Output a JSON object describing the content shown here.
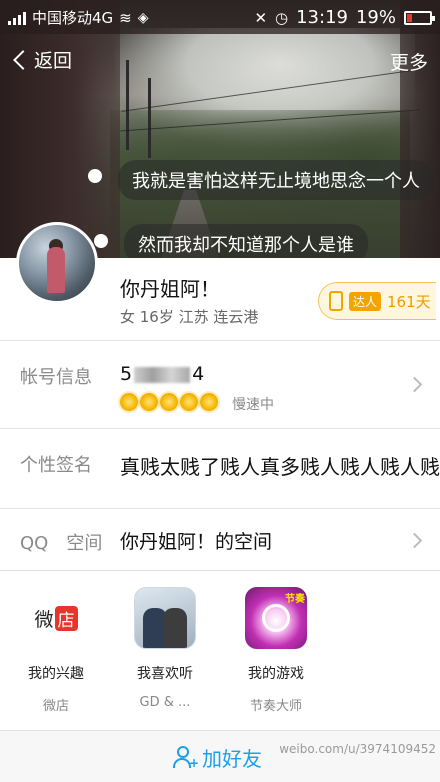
{
  "status_bar": {
    "carrier": "中国移动4G",
    "time": "13:19",
    "battery_percent": "19%"
  },
  "nav": {
    "back_label": "返回",
    "more_label": "更多"
  },
  "cover": {
    "bubble_1": "我就是害怕这样无止境地思念一个人",
    "bubble_2": "然而我却不知道那个人是谁"
  },
  "profile": {
    "name": "你丹姐阿！",
    "meta": "女  16岁  江苏  连云港",
    "badge_tag": "达人",
    "badge_days": "161天"
  },
  "account": {
    "label": "帐号信息",
    "id_start": "5",
    "id_end": "4",
    "level_icons": 5,
    "speed": "慢速中"
  },
  "signature": {
    "label": "个性签名",
    "text": "真贱太贱了贱人真多贱人贱人贱人贱"
  },
  "qzone": {
    "label": "QQ　空间",
    "text": "你丹姐阿！的空间"
  },
  "apps": [
    {
      "title": "我的兴趣",
      "sub": "微店",
      "icon_text_1": "微",
      "icon_text_2": "店"
    },
    {
      "title": "我喜欢听",
      "sub": "GD & ..."
    },
    {
      "title": "我的游戏",
      "sub": "节奏大师",
      "icon_text": "节奏"
    }
  ],
  "bottom": {
    "add_friend_label": "加好友"
  },
  "watermark": "weibo.com/u/3974109452"
}
